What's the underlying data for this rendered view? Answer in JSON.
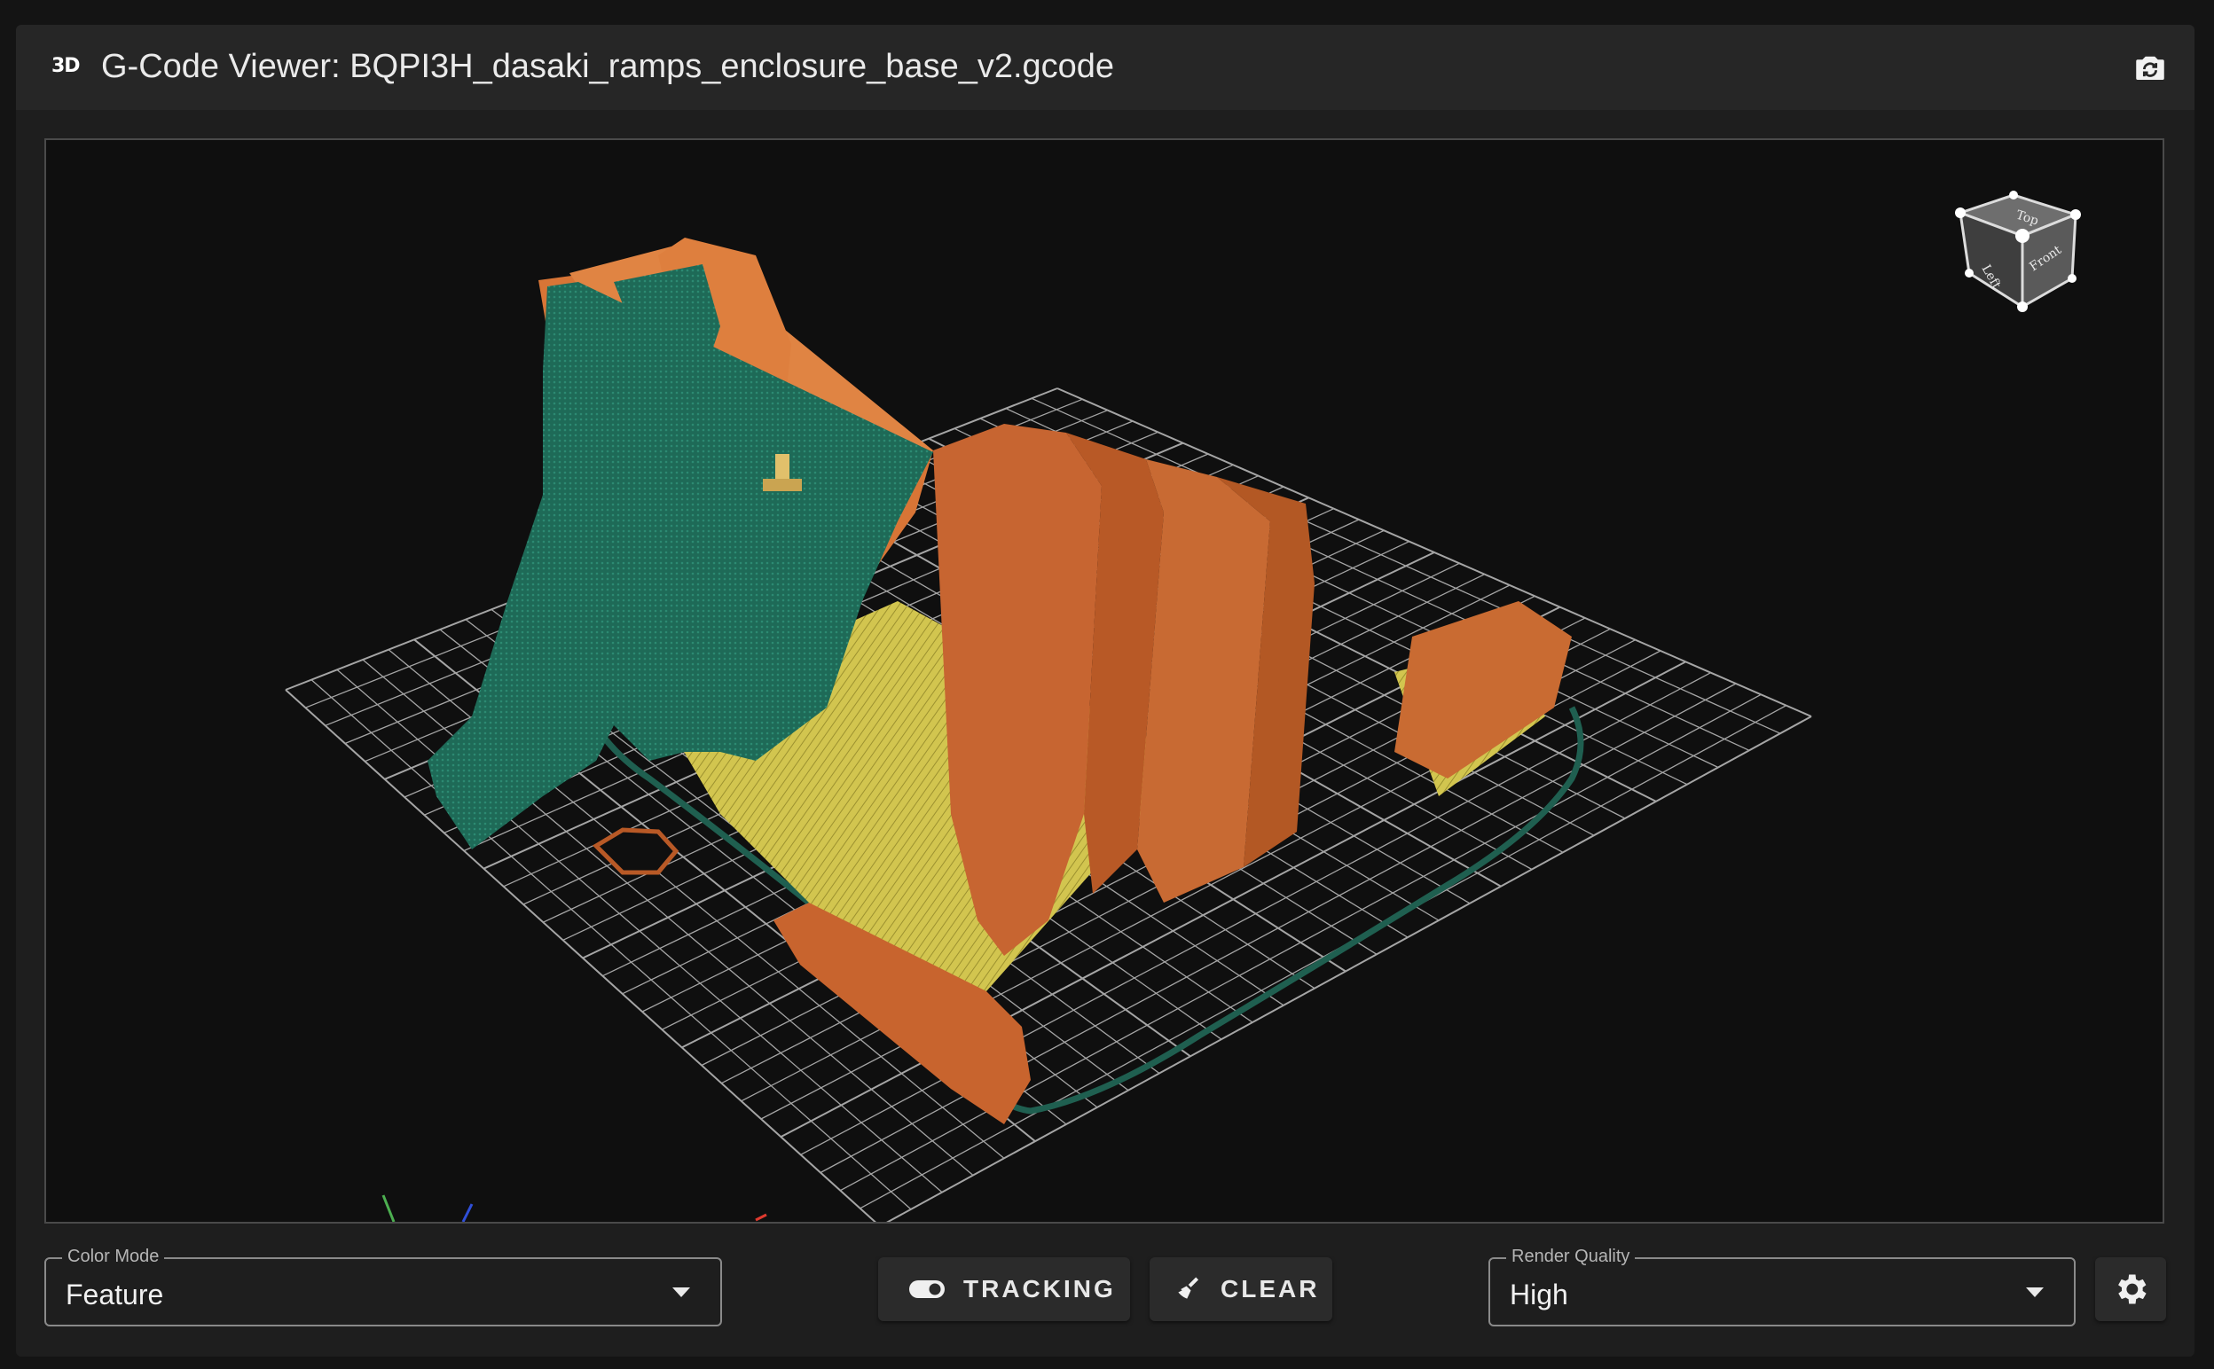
{
  "header": {
    "badge": "3D",
    "title": "G-Code Viewer: BQPI3H_dasaki_ramps_enclosure_base_v2.gcode",
    "screenshot_icon": "camera-rotate-icon"
  },
  "navcube": {
    "faces": {
      "top": "Top",
      "left": "Left",
      "front": "Front"
    }
  },
  "controls": {
    "color_mode": {
      "label": "Color Mode",
      "value": "Feature"
    },
    "tracking_button": {
      "label": "TRACKING",
      "icon": "toggle-icon"
    },
    "clear_button": {
      "label": "CLEAR",
      "icon": "broom-icon"
    },
    "render_quality": {
      "label": "Render Quality",
      "value": "High"
    },
    "settings_icon": "gear-icon"
  },
  "colors": {
    "wall": "#d9773a",
    "infill": "#d7cc55",
    "support": "#1f6b58",
    "travel": "#1f5f50",
    "grid": "#d0d0d0",
    "background": "#0f0f0f"
  }
}
